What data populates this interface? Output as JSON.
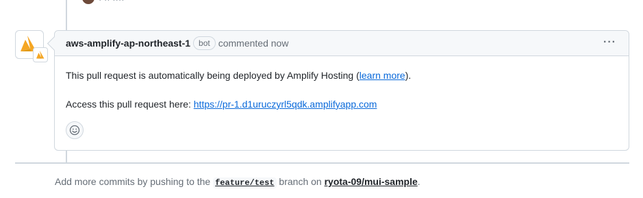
{
  "comment": {
    "author": "aws-amplify-ap-northeast-1",
    "badge": "bot",
    "meta": "commented now",
    "menu_label": "···",
    "body": {
      "line1_prefix": "This pull request is automatically being deployed by Amplify Hosting (",
      "line1_link": "learn more",
      "line1_suffix": ").",
      "line2_prefix": "Access this pull request here: ",
      "line2_link": "https://pr-1.d1uruczyrl5qdk.amplifyapp.com"
    }
  },
  "previous_item": {
    "dots": "···"
  },
  "footer": {
    "prefix": "Add more commits by pushing to the ",
    "branch": "feature/test",
    "middle": " branch on ",
    "repo": "ryota-09/mui-sample",
    "suffix": "."
  },
  "colors": {
    "amplify_orange": "#f5a623",
    "amplify_dark": "#e29a17",
    "link": "#0969da",
    "border": "#d0d7de"
  },
  "icons": {
    "avatar": "amplify-logo-icon",
    "reaction": "smiley-icon",
    "menu": "kebab-icon"
  }
}
